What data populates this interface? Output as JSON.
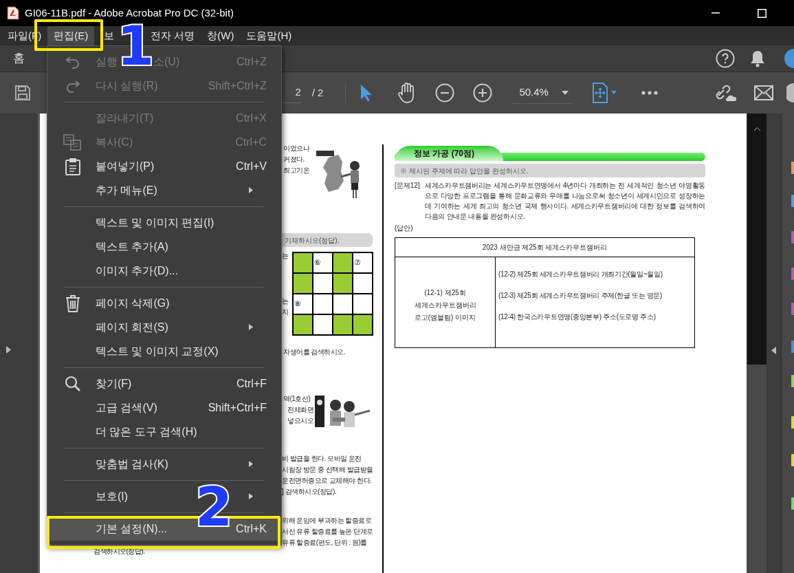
{
  "window": {
    "title": "GI06-11B.pdf - Adobe Acrobat Pro DC (32-bit)"
  },
  "menu_bar": [
    {
      "label": "파일(F)",
      "selected": false
    },
    {
      "label": "편집(E)",
      "selected": true
    },
    {
      "label": "보",
      "selected": false
    },
    {
      "label": "전자 서명",
      "selected": false
    },
    {
      "label": "창(W)",
      "selected": false
    },
    {
      "label": "도움말(H)",
      "selected": false
    }
  ],
  "home_tab": "홈",
  "toolbar": {
    "page_current": "2",
    "page_total": "/ 2",
    "zoom": "50.4%"
  },
  "edit_menu": [
    {
      "kind": "item",
      "label": "실행",
      "label_tail": "소(U)",
      "shortcut": "Ctrl+Z",
      "disabled": true,
      "submenu": false,
      "selected": false
    },
    {
      "kind": "item",
      "label": "다시 실행(R)",
      "shortcut": "Shift+Ctrl+Z",
      "disabled": true,
      "submenu": false,
      "selected": false
    },
    {
      "kind": "separator"
    },
    {
      "kind": "item",
      "label": "잘라내기(T)",
      "shortcut": "Ctrl+X",
      "disabled": true,
      "submenu": false,
      "selected": false
    },
    {
      "kind": "item",
      "label": "복사(C)",
      "shortcut": "Ctrl+C",
      "disabled": true,
      "submenu": false,
      "selected": false
    },
    {
      "kind": "item",
      "label": "붙여넣기(P)",
      "shortcut": "Ctrl+V",
      "disabled": false,
      "submenu": false,
      "selected": false
    },
    {
      "kind": "item",
      "label": "추가 메뉴(E)",
      "disabled": false,
      "submenu": true,
      "selected": false
    },
    {
      "kind": "separator"
    },
    {
      "kind": "item",
      "label": "텍스트 및 이미지 편집(I)",
      "disabled": false,
      "submenu": false,
      "selected": false
    },
    {
      "kind": "item",
      "label": "텍스트 추가(A)",
      "disabled": false,
      "submenu": false,
      "selected": false
    },
    {
      "kind": "item",
      "label": "이미지 추가(D)...",
      "disabled": false,
      "submenu": false,
      "selected": false
    },
    {
      "kind": "separator"
    },
    {
      "kind": "item",
      "label": "페이지 삭제(G)",
      "disabled": false,
      "submenu": false,
      "selected": false
    },
    {
      "kind": "item",
      "label": "페이지 회전(S)",
      "disabled": false,
      "submenu": true,
      "selected": false
    },
    {
      "kind": "item",
      "label": "텍스트 및 이미지 교정(X)",
      "disabled": false,
      "submenu": false,
      "selected": false
    },
    {
      "kind": "separator"
    },
    {
      "kind": "item",
      "label": "찾기(F)",
      "shortcut": "Ctrl+F",
      "disabled": false,
      "submenu": false,
      "selected": false
    },
    {
      "kind": "item",
      "label": "고급 검색(V)",
      "shortcut": "Shift+Ctrl+F",
      "disabled": false,
      "submenu": false,
      "selected": false
    },
    {
      "kind": "item",
      "label": "더 많은 도구 검색(H)",
      "disabled": false,
      "submenu": false,
      "selected": false
    },
    {
      "kind": "separator"
    },
    {
      "kind": "item",
      "label": "맞춤법 검사(K)",
      "disabled": false,
      "submenu": true,
      "selected": false
    },
    {
      "kind": "separator"
    },
    {
      "kind": "item",
      "label": "보호(I)",
      "disabled": false,
      "submenu": true,
      "selected": false
    },
    {
      "kind": "separator"
    },
    {
      "kind": "item",
      "label": "기본 설정(N)...",
      "shortcut": "Ctrl+K",
      "disabled": false,
      "submenu": false,
      "selected": true
    }
  ],
  "document": {
    "left_fragments": [
      {
        "kind": "text",
        "text": "이었으나"
      },
      {
        "kind": "text",
        "text": "커졌다."
      },
      {
        "kind": "text",
        "text": "최고기온"
      },
      {
        "kind": "bar",
        "text": "기재하시오(정답)."
      },
      {
        "kind": "text",
        "text": "는"
      },
      {
        "kind": "text",
        "text": "는"
      },
      {
        "kind": "text",
        "text": "지"
      },
      {
        "kind": "text",
        "text": "자생어를 검색하시오."
      },
      {
        "kind": "text",
        "text": "역(1호선)"
      },
      {
        "kind": "text",
        "text": "전체화면"
      },
      {
        "kind": "text",
        "text": "넣으시오"
      },
      {
        "kind": "text",
        "text": "비 발급을 한다. 모바일 운전"
      },
      {
        "kind": "text",
        "text": "시험장 방문 중 선택해 발급받을"
      },
      {
        "kind": "text",
        "text": "운전면허증으로 교체해야 한다."
      },
      {
        "kind": "text",
        "text": "] 검색하시오(정답)."
      },
      {
        "kind": "text",
        "text": "위해 운임에 부과하는 할증료로"
      },
      {
        "kind": "text",
        "text": "서선 유류 할증료를 높은 단계로"
      },
      {
        "kind": "text",
        "text": "유류 할증료(편도, 단위 : 원)를"
      },
      {
        "kind": "text",
        "text": "검색하시오(정답)."
      }
    ],
    "crossword": [
      [
        {
          "shaded": true
        },
        {
          "shaded": false,
          "label": "⑥"
        },
        {
          "shaded": true
        },
        {
          "shaded": false,
          "label": "⑦"
        }
      ],
      [
        {
          "shaded": true
        },
        {
          "shaded": false
        },
        {
          "shaded": true
        },
        {
          "shaded": false
        }
      ],
      [
        {
          "shaded": false,
          "label": "⑧"
        },
        {
          "shaded": false
        },
        {
          "shaded": false
        },
        {
          "shaded": false
        }
      ],
      [
        {
          "shaded": true
        },
        {
          "shaded": false
        },
        {
          "shaded": true
        },
        {
          "shaded": true
        }
      ]
    ],
    "section_title": "정보 가공 (70점)",
    "instruction": "※ 제시된 주제에 따라 답안을 완성하시오.",
    "question_label": "[문제12]",
    "question_text": "세계스카우트잼버리는 세계스카우트연맹에서 4년마다 개최하는 전 세계적인 청소년 야영활동으로 다양한 프로그램을 통해 문화교류와 우애를 나눔으로써 청소년이 세계시민으로 성장하는 데 기여하는 세계 최고의 청소년 국제 행사이다. 세계스카우트잼버리에 대한 정보를 검색하여 다음의 안내문 내용을 완성하시오.",
    "answer_label": "(답안)",
    "answer_table": {
      "header": "2023 새만금 제25회 세계스카우트잼버리",
      "left_lines": [
        "(12-1) 제25회",
        "세계스카우트잼버리",
        "로고(엠블럼) 이미지"
      ],
      "right_lines": [
        "(12-2) 제25회 세계스카우트잼버리 개최기간(월일~월일)",
        "(12-3) 제25회 세계스카우트잼버리 주제(한글 또는 영문)",
        "(12-4) 한국스카우트연맹(중앙본부) 주소(도로명 주소)"
      ]
    }
  },
  "annotations": [
    {
      "label": "1"
    },
    {
      "label": "2"
    }
  ]
}
